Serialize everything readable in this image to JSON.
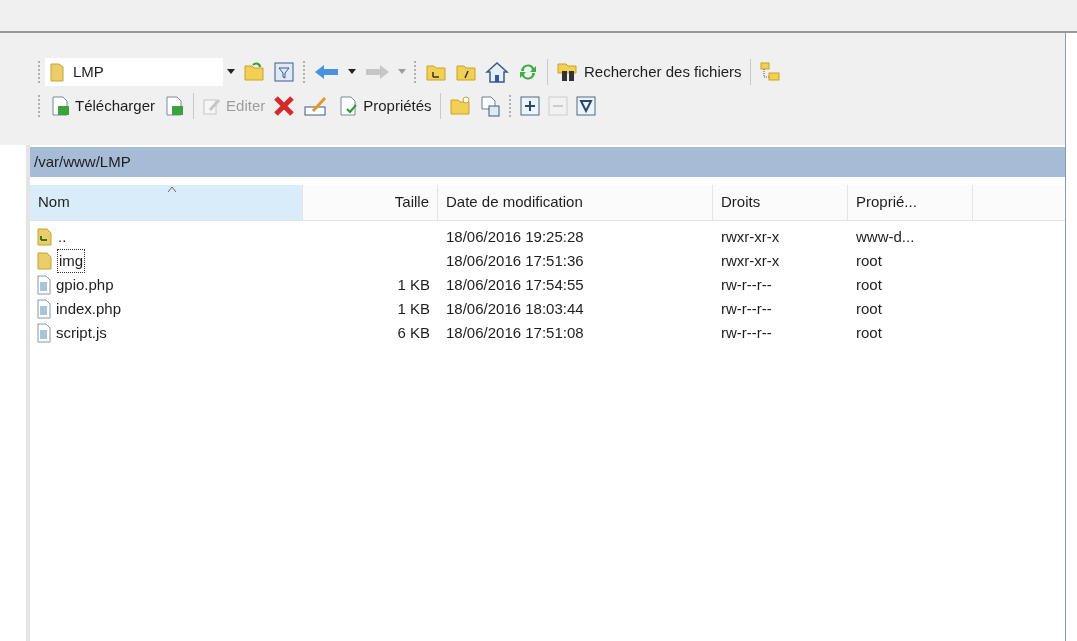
{
  "toolbar_top": {
    "location": "LMP",
    "back_disabled": false,
    "forward_disabled": true,
    "search_label": "Rechercher des fichiers"
  },
  "toolbar_bottom": {
    "download_label": "Télécharger",
    "edit": {
      "label": "Editer",
      "disabled": true
    },
    "properties_label": "Propriétés",
    "collapse_disabled": true
  },
  "path": "/var/www/LMP",
  "table": {
    "columns": [
      {
        "label": "Nom",
        "sorted": true
      },
      {
        "label": "Taille",
        "sorted": false
      },
      {
        "label": "Date de modification",
        "sorted": false
      },
      {
        "label": "Droits",
        "sorted": false
      },
      {
        "label": "Proprié...",
        "sorted": false
      }
    ],
    "rows": [
      {
        "kind": "parent",
        "focused": false,
        "cells": [
          "..",
          "",
          "18/06/2016 19:25:28",
          "rwxr-xr-x",
          "www-d..."
        ]
      },
      {
        "kind": "folder",
        "focused": true,
        "cells": [
          "img",
          "",
          "18/06/2016 17:51:36",
          "rwxr-xr-x",
          "root"
        ]
      },
      {
        "kind": "file",
        "focused": false,
        "cells": [
          "gpio.php",
          "1 KB",
          "18/06/2016 17:54:55",
          "rw-r--r--",
          "root"
        ]
      },
      {
        "kind": "file",
        "focused": false,
        "cells": [
          "index.php",
          "1 KB",
          "18/06/2016 18:03:44",
          "rw-r--r--",
          "root"
        ]
      },
      {
        "kind": "file",
        "focused": false,
        "cells": [
          "script.js",
          "6 KB",
          "18/06/2016 17:51:08",
          "rw-r--r--",
          "root"
        ]
      }
    ]
  }
}
